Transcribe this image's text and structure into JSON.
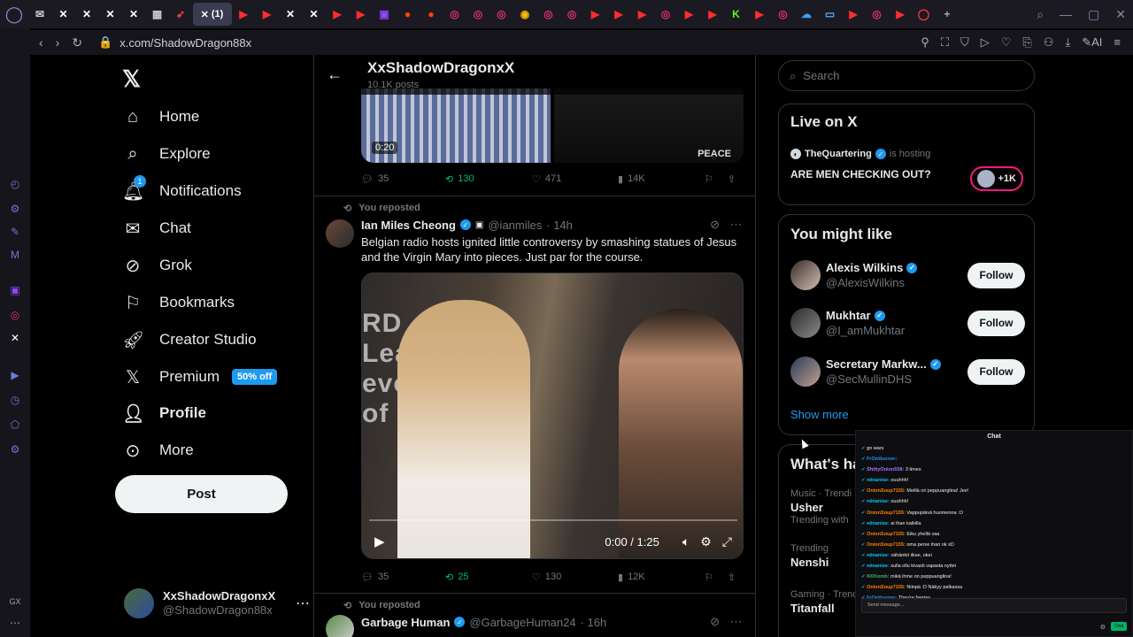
{
  "browser": {
    "active_tab_label": "(1)",
    "url": "x.com/ShadowDragon88x",
    "tab_icons": [
      "mail-icon",
      "x-icon",
      "x-icon",
      "x-icon",
      "x-icon",
      "image-icon",
      "arrow-icon",
      "x-icon",
      "youtube-icon",
      "youtube-icon",
      "x-icon",
      "x-icon",
      "play-icon",
      "play-icon",
      "twitch-icon",
      "reddit-icon",
      "reddit-icon",
      "instagram-icon",
      "instagram-icon",
      "instagram-icon",
      "chrome-icon",
      "instagram-icon",
      "instagram-icon",
      "youtube-icon",
      "youtube-icon",
      "youtube-icon",
      "instagram-icon",
      "youtube-icon",
      "youtube-icon",
      "kick-icon",
      "youtube-icon",
      "instagram-icon",
      "cloud-icon",
      "tv-icon",
      "youtube-icon",
      "instagram-icon",
      "youtube-icon",
      "opera-icon",
      "add-tab-icon"
    ],
    "ai_label": "AI"
  },
  "nav": {
    "items": [
      {
        "label": "Home",
        "icon": "home-icon"
      },
      {
        "label": "Explore",
        "icon": "search-icon"
      },
      {
        "label": "Notifications",
        "icon": "bell-icon",
        "badge": "1"
      },
      {
        "label": "Chat",
        "icon": "mail-icon"
      },
      {
        "label": "Grok",
        "icon": "grok-icon"
      },
      {
        "label": "Bookmarks",
        "icon": "bookmark-icon"
      },
      {
        "label": "Creator Studio",
        "icon": "rocket-icon"
      },
      {
        "label": "Premium",
        "icon": "x-icon",
        "badge": "50% off"
      },
      {
        "label": "Profile",
        "icon": "person-icon"
      },
      {
        "label": "More",
        "icon": "more-circle-icon"
      }
    ],
    "post_label": "Post",
    "account": {
      "name": "XxShadowDragonxX",
      "handle": "@ShadowDragon88x"
    }
  },
  "profile_header": {
    "name": "XxShadowDragonxX",
    "posts": "10.1K posts"
  },
  "post1": {
    "duration": "0:20",
    "media_text": "PEACE",
    "replies": "35",
    "reposts": "130",
    "likes": "471",
    "views": "14K"
  },
  "post2": {
    "reposted": "You reposted",
    "name": "Ian Miles Cheong",
    "handle": "@ianmiles",
    "time": "· 14h",
    "text": "Belgian radio hosts ignited little controversy by smashing statues of Jesus and the Virgin Mary into pieces. Just par for the course.",
    "video_sign": "RD\nLeading\nevoluti\nof audi",
    "video_time": "0:00 / 1:25",
    "replies": "35",
    "reposts": "25",
    "likes": "130",
    "views": "12K"
  },
  "post3": {
    "reposted": "You reposted",
    "name": "Garbage Human",
    "handle": "@GarbageHuman24",
    "time": "· 16h"
  },
  "right": {
    "search_placeholder": "Search",
    "live": {
      "title": "Live on X",
      "host": "TheQuartering",
      "hosting": "is hosting",
      "topic": "ARE MEN CHECKING OUT?",
      "count": "+1K"
    },
    "wtf": {
      "title": "You might like",
      "users": [
        {
          "name": "Alexis Wilkins",
          "handle": "@AlexisWilkins",
          "follow": "Follow"
        },
        {
          "name": "Mukhtar",
          "handle": "@I_amMukhtar",
          "follow": "Follow"
        },
        {
          "name": "Secretary Markw...",
          "handle": "@SecMullinDHS",
          "follow": "Follow"
        }
      ],
      "show_more": "Show more"
    },
    "trends": {
      "title": "What's ha",
      "items": [
        {
          "meta": "Music · Trendi",
          "topic": "Usher",
          "extra": "Trending with"
        },
        {
          "meta": "Trending",
          "topic": "Nenshi",
          "extra": ""
        },
        {
          "meta": "Gaming · Trenc",
          "topic": "Titanfall",
          "extra": ""
        }
      ]
    }
  },
  "chat": {
    "title": "Chat",
    "messages": [
      {
        "user": "",
        "text": "gn wars"
      },
      {
        "user": "FrOntburner:",
        "text": ""
      },
      {
        "user": "ShittyOnion558:",
        "text": "3 times"
      },
      {
        "user": "niinanise:",
        "text": "ouuhhh!"
      },
      {
        "user": "OnionSoup7155:",
        "text": "Meillä on peppuanglina! Jee!"
      },
      {
        "user": "niinanise:",
        "text": "ouuhhh!"
      },
      {
        "user": "OnionSoup7155:",
        "text": "Vappupäivä huomenna :O"
      },
      {
        "user": "niinanise:",
        "text": "ai ihan kaikilla"
      },
      {
        "user": "OnionSoup7155:",
        "text": "Eiku yhellä vaa"
      },
      {
        "user": "OnionSoup7155:",
        "text": "oma perse ihan ok xD"
      },
      {
        "user": "niinanise:",
        "text": "vähänkö iikse, okei"
      },
      {
        "user": "niinanise:",
        "text": "sulla ollu kivasti vapasta nyttei"
      },
      {
        "user": "KKKomb:",
        "text": "mikä ihme on peppuanglina!"
      },
      {
        "user": "OnionSoup7155:",
        "text": "Niinpä :D Näkyy palkassa"
      },
      {
        "user": "FrOntburner:",
        "text": "They're faeries"
      }
    ],
    "input_placeholder": "Send message...",
    "send_label": "Chat"
  }
}
